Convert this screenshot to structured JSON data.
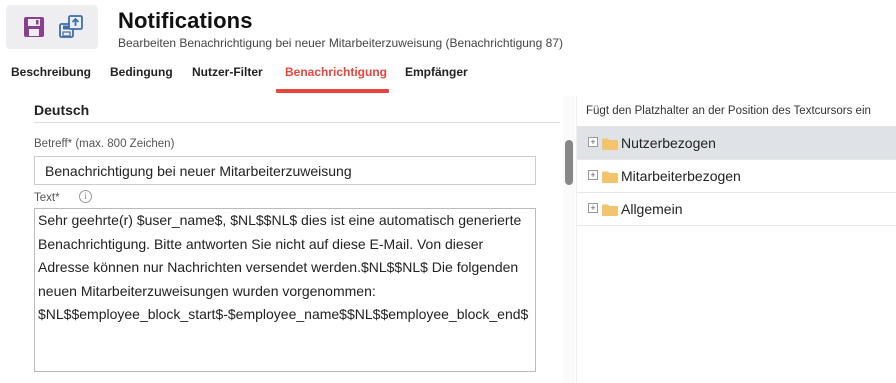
{
  "header": {
    "title": "Notifications",
    "subtitle": "Bearbeiten Benachrichtigung bei neuer Mitarbeiterzuweisung (Benachrichtigung 87)",
    "icons": [
      "save-icon",
      "save-as-icon"
    ]
  },
  "tabs": [
    {
      "label": "Beschreibung",
      "active": false
    },
    {
      "label": "Bedingung",
      "active": false
    },
    {
      "label": "Nutzer-Filter",
      "active": false
    },
    {
      "label": "Benachrichtigung",
      "active": true
    },
    {
      "label": "Empfänger",
      "active": false
    }
  ],
  "editor": {
    "section_title": "Deutsch",
    "subject_label": "Betreff* (max. 800 Zeichen)",
    "subject_value": "Benachrichtigung bei neuer Mitarbeiterzuweisung",
    "text_label": "Text*",
    "info_icon": "i",
    "text_value": "Sehr geehrte(r) $user_name$, $NL$$NL$ dies ist eine automatisch generierte Benachrichtigung. Bitte antworten Sie nicht auf diese E-Mail. Von dieser Adresse können nur Nachrichten versendet werden.$NL$$NL$ Die folgenden neuen Mitarbeiterzuweisungen wurden vorgenommen: $NL$$employee_block_start$-$employee_name$$NL$$employee_block_end$"
  },
  "placeholders": {
    "hint": "Fügt den Platzhalter an der Position des Textcursors ein",
    "items": [
      {
        "label": "Nutzerbezogen",
        "selected": true,
        "expander": "+"
      },
      {
        "label": "Mitarbeiterbezogen",
        "selected": false,
        "expander": "+"
      },
      {
        "label": "Allgemein",
        "selected": false,
        "expander": "+"
      }
    ]
  },
  "colors": {
    "accent": "#e8453c",
    "save_icon": "#8a3f8f",
    "folder": "#f2c46d",
    "selected_row": "#dfe3e8"
  }
}
